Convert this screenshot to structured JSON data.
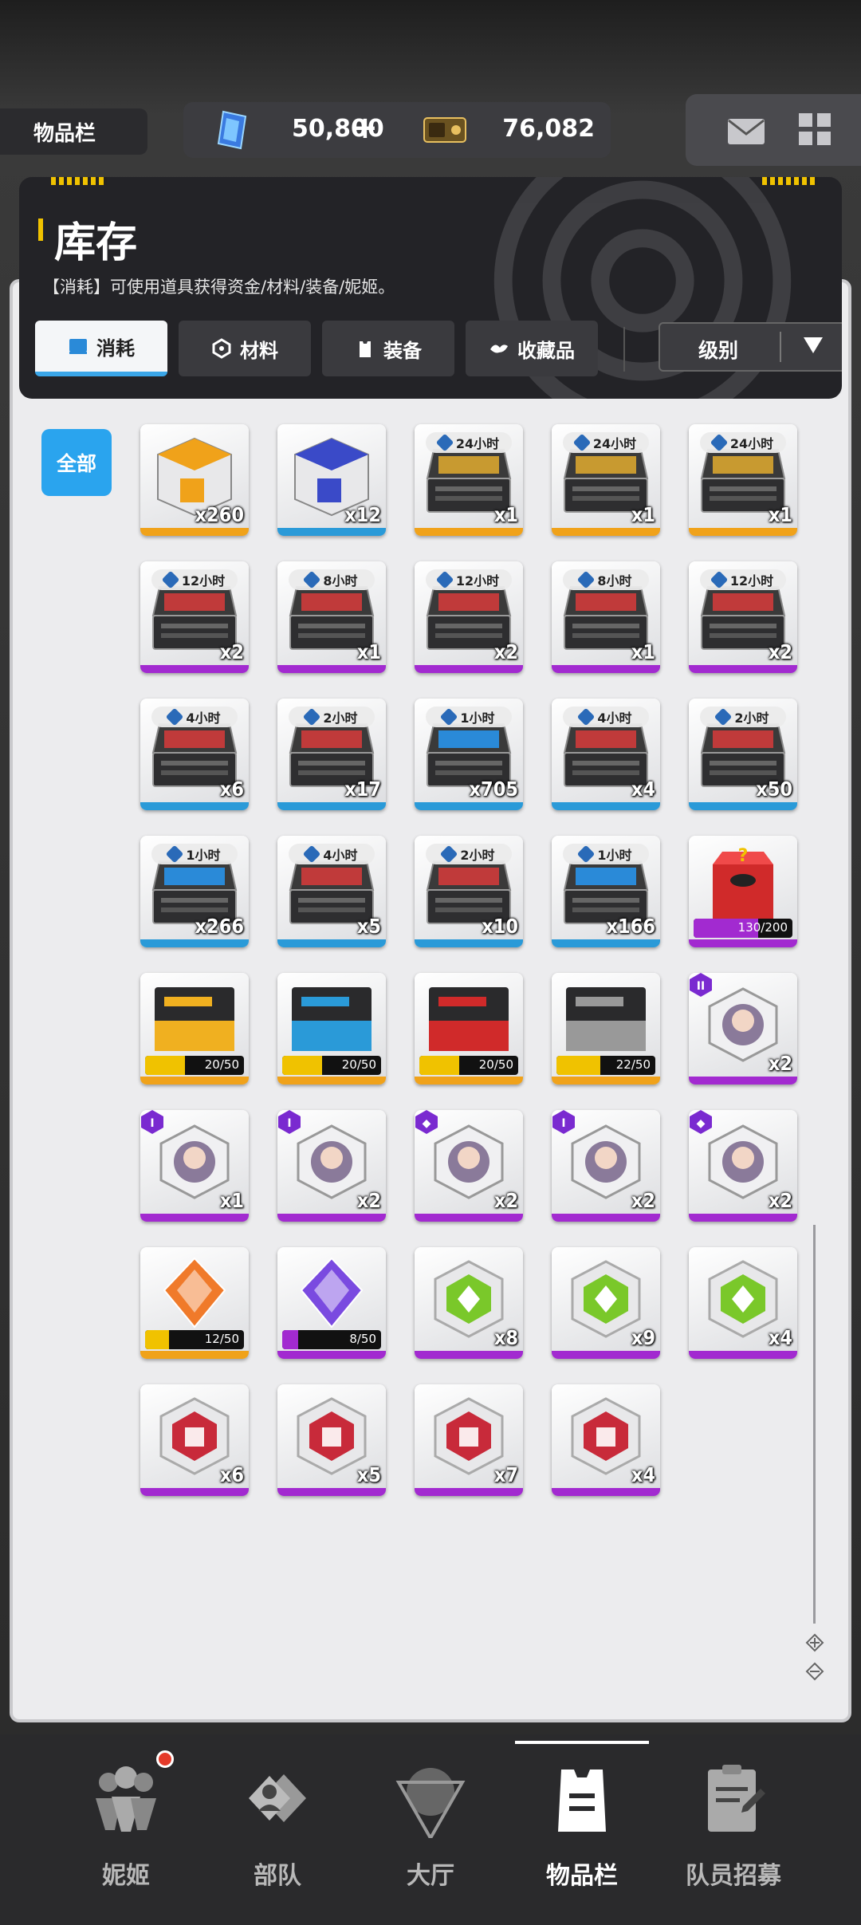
{
  "topbar": {
    "page_tag": "物品栏",
    "gems": "50,800",
    "gems_plus": "+",
    "tickets": "76,082"
  },
  "header": {
    "title": "库存",
    "description": "【消耗】可使用道具获得资金/材料/装备/妮姬。",
    "tabs": [
      {
        "label": "消耗",
        "icon": "consumable-icon",
        "active": true
      },
      {
        "label": "材料",
        "icon": "material-icon",
        "active": false
      },
      {
        "label": "装备",
        "icon": "equipment-icon",
        "active": false
      },
      {
        "label": "收藏品",
        "icon": "collectible-icon",
        "active": false
      }
    ],
    "sort": "级别"
  },
  "filter": {
    "all": "全部"
  },
  "items": [
    {
      "name": "orange-supply-box",
      "qty": "x260",
      "rarity": "gold"
    },
    {
      "name": "blue-supply-box",
      "qty": "x12",
      "rarity": "blue"
    },
    {
      "name": "case-24h-a",
      "timer": "24小时",
      "qty": "x1",
      "rarity": "gold"
    },
    {
      "name": "case-24h-b",
      "timer": "24小时",
      "qty": "x1",
      "rarity": "gold"
    },
    {
      "name": "case-24h-c",
      "timer": "24小时",
      "qty": "x1",
      "rarity": "gold"
    },
    {
      "name": "case-12h-a",
      "timer": "12小时",
      "qty": "x2",
      "rarity": "purple"
    },
    {
      "name": "case-8h-a",
      "timer": "8小时",
      "qty": "x1",
      "rarity": "purple"
    },
    {
      "name": "case-12h-b",
      "timer": "12小时",
      "qty": "x2",
      "rarity": "purple"
    },
    {
      "name": "case-8h-b",
      "timer": "8小时",
      "qty": "x1",
      "rarity": "purple"
    },
    {
      "name": "case-12h-c",
      "timer": "12小时",
      "qty": "x2",
      "rarity": "purple"
    },
    {
      "name": "case-4h-a",
      "timer": "4小时",
      "qty": "x6",
      "rarity": "blue"
    },
    {
      "name": "case-2h-a",
      "timer": "2小时",
      "qty": "x17",
      "rarity": "blue"
    },
    {
      "name": "case-1h-a",
      "timer": "1小时",
      "qty": "x705",
      "rarity": "blue"
    },
    {
      "name": "case-4h-b",
      "timer": "4小时",
      "qty": "x4",
      "rarity": "blue"
    },
    {
      "name": "case-2h-b",
      "timer": "2小时",
      "qty": "x50",
      "rarity": "blue"
    },
    {
      "name": "case-1h-b",
      "timer": "1小时",
      "qty": "x266",
      "rarity": "blue"
    },
    {
      "name": "case-4h-c",
      "timer": "4小时",
      "qty": "x5",
      "rarity": "blue"
    },
    {
      "name": "case-2h-c",
      "timer": "2小时",
      "qty": "x10",
      "rarity": "blue"
    },
    {
      "name": "case-1h-c",
      "timer": "1小时",
      "qty": "x166",
      "rarity": "blue"
    },
    {
      "name": "lucky-box",
      "progress": "130/200",
      "fill": 0.65,
      "rarity": "purple"
    },
    {
      "name": "tetra-pass",
      "progress": "20/50",
      "fill": 0.4,
      "rarity": "gold"
    },
    {
      "name": "missilis-pass",
      "progress": "20/50",
      "fill": 0.4,
      "rarity": "gold"
    },
    {
      "name": "elysion-pass",
      "progress": "20/50",
      "fill": 0.4,
      "rarity": "gold"
    },
    {
      "name": "pilgrim-pass",
      "progress": "22/50",
      "fill": 0.44,
      "rarity": "gold"
    },
    {
      "name": "nikke-core-1",
      "qty": "x2",
      "rarity": "purple",
      "badge": "II"
    },
    {
      "name": "nikke-core-2",
      "qty": "x1",
      "rarity": "purple",
      "badge": "I"
    },
    {
      "name": "nikke-core-3",
      "qty": "x2",
      "rarity": "purple",
      "badge": "I"
    },
    {
      "name": "nikke-core-4",
      "qty": "x2",
      "rarity": "purple",
      "badge": "◆"
    },
    {
      "name": "nikke-core-5",
      "qty": "x2",
      "rarity": "purple",
      "badge": "I"
    },
    {
      "name": "nikke-core-6",
      "qty": "x2",
      "rarity": "purple",
      "badge": "◆"
    },
    {
      "name": "ssr-crystal",
      "progress": "12/50",
      "fill": 0.24,
      "rarity": "gold"
    },
    {
      "name": "sr-crystal",
      "progress": "8/50",
      "fill": 0.16,
      "rarity": "purple"
    },
    {
      "name": "green-module-1",
      "qty": "x8",
      "rarity": "purple"
    },
    {
      "name": "green-module-2",
      "qty": "x9",
      "rarity": "purple"
    },
    {
      "name": "green-module-3",
      "qty": "x4",
      "rarity": "purple"
    },
    {
      "name": "red-module-1",
      "qty": "x6",
      "rarity": "purple"
    },
    {
      "name": "red-module-2",
      "qty": "x5",
      "rarity": "purple"
    },
    {
      "name": "red-module-3",
      "qty": "x7",
      "rarity": "purple"
    },
    {
      "name": "red-module-4",
      "qty": "x4",
      "rarity": "purple"
    }
  ],
  "nav": [
    {
      "label": "妮姬",
      "icon": "nikke-icon",
      "active": false,
      "notification": true
    },
    {
      "label": "部队",
      "icon": "squad-icon",
      "active": false
    },
    {
      "label": "大厅",
      "icon": "lobby-icon",
      "active": false
    },
    {
      "label": "物品栏",
      "icon": "inventory-icon",
      "active": true
    },
    {
      "label": "队员招募",
      "icon": "recruit-icon",
      "active": false
    }
  ],
  "colors": {
    "accent_blue": "#2aa4ee",
    "rarity_gold": "#f0a21a",
    "rarity_blue": "#2a9ad8",
    "rarity_purple": "#a22ad0",
    "notification_red": "#e43a2a"
  }
}
